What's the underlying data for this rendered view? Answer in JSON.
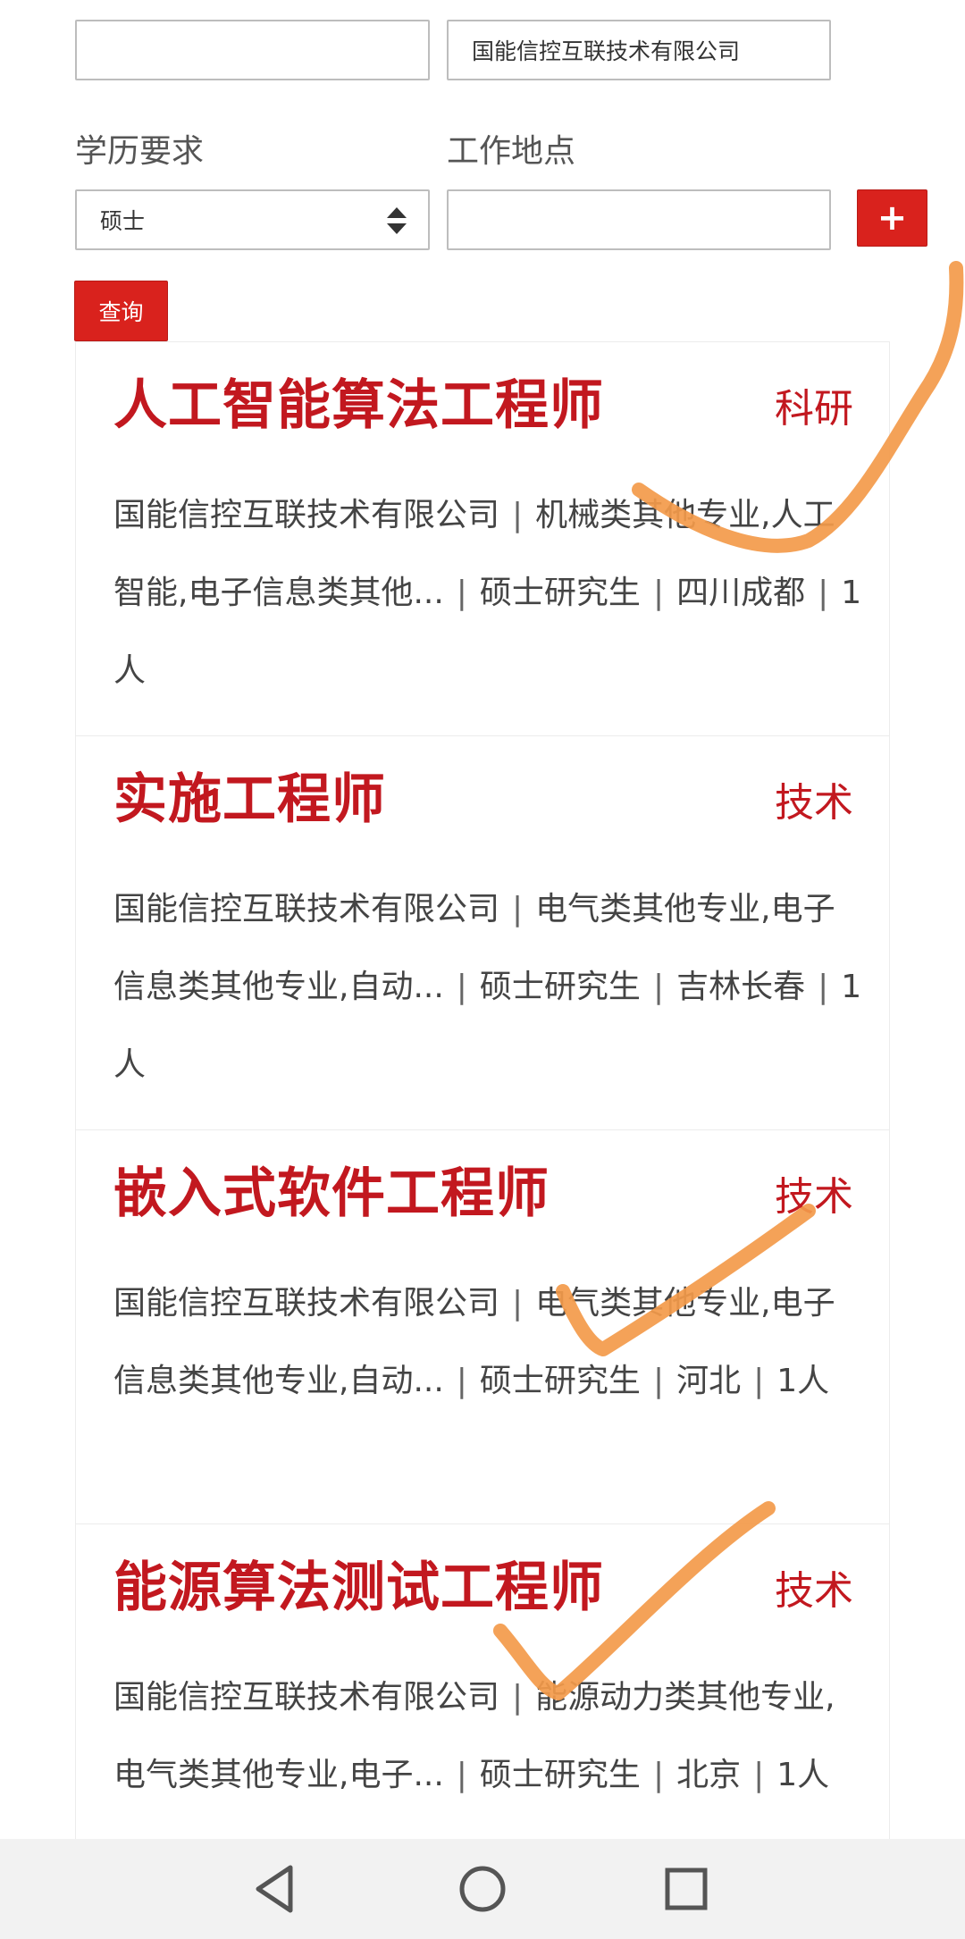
{
  "filters": {
    "top_left_value": "",
    "company_value": "国能信控互联技术有限公司",
    "education_label": "学历要求",
    "education_selected": "硕士",
    "location_label": "工作地点",
    "location_value": "",
    "add_label": "+",
    "search_label": "查询"
  },
  "jobs": [
    {
      "title": "人工智能算法工程师",
      "category": "科研",
      "company": "国能信控互联技术有限公司",
      "majors": "机械类其他专业,人工智能,电子信息类其他...",
      "education": "硕士研究生",
      "location": "四川成都",
      "count": "1人"
    },
    {
      "title": "实施工程师",
      "category": "技术",
      "company": "国能信控互联技术有限公司",
      "majors": "电气类其他专业,电子信息类其他专业,自动...",
      "education": "硕士研究生",
      "location": "吉林长春",
      "count": "1人"
    },
    {
      "title": "嵌入式软件工程师",
      "category": "技术",
      "company": "国能信控互联技术有限公司",
      "majors": "电气类其他专业,电子信息类其他专业,自动...",
      "education": "硕士研究生",
      "location": "河北",
      "count": "1人"
    },
    {
      "title": "能源算法测试工程师",
      "category": "技术",
      "company": "国能信控互联技术有限公司",
      "majors": "能源动力类其他专业,电气类其他专业,电子...",
      "education": "硕士研究生",
      "location": "北京",
      "count": "1人"
    }
  ],
  "separator": "|",
  "icons": {
    "back": "back-triangle-icon",
    "home": "home-circle-icon",
    "recents": "recents-square-icon",
    "select_arrows": "select-arrows-icon"
  },
  "colors": {
    "accent_red": "#c2181f",
    "button_red": "#d9221d",
    "annotation_orange": "#f39a4a"
  }
}
